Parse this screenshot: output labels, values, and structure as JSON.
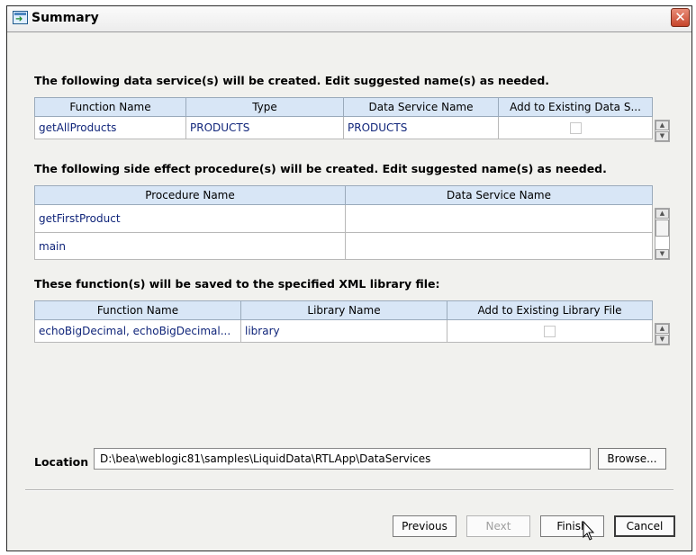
{
  "window": {
    "title": "Summary",
    "close_label": "✕"
  },
  "services": {
    "heading": "The following data service(s) will be created.  Edit suggested name(s) as needed.",
    "columns": [
      "Function Name",
      "Type",
      "Data Service Name",
      "Add to Existing Data S..."
    ],
    "rows": [
      {
        "function_name": "getAllProducts",
        "type": "PRODUCTS",
        "data_service_name": "PRODUCTS",
        "add_existing": false
      }
    ]
  },
  "procedures": {
    "heading": "The following side effect procedure(s) will be created.  Edit suggested name(s) as needed.",
    "columns": [
      "Procedure Name",
      "Data Service Name"
    ],
    "rows": [
      {
        "procedure_name": "getFirstProduct",
        "data_service_name": ""
      },
      {
        "procedure_name": "main",
        "data_service_name": ""
      }
    ]
  },
  "library": {
    "heading": "These function(s) will be saved to the specified XML library file:",
    "columns": [
      "Function Name",
      "Library Name",
      "Add to Existing Library File"
    ],
    "rows": [
      {
        "function_name": "echoBigDecimal, echoBigDecimal...",
        "library_name": "library",
        "add_existing": false
      }
    ]
  },
  "location": {
    "label": "Location",
    "value": "D:\\bea\\weblogic81\\samples\\LiquidData\\RTLApp\\DataServices",
    "browse_label": "Browse..."
  },
  "buttons": {
    "previous": "Previous",
    "next": "Next",
    "finish": "Finish",
    "cancel": "Cancel"
  },
  "icons": {
    "scroll_up": "▲",
    "scroll_down": "▼",
    "title_icon": "wizard-window-icon"
  }
}
